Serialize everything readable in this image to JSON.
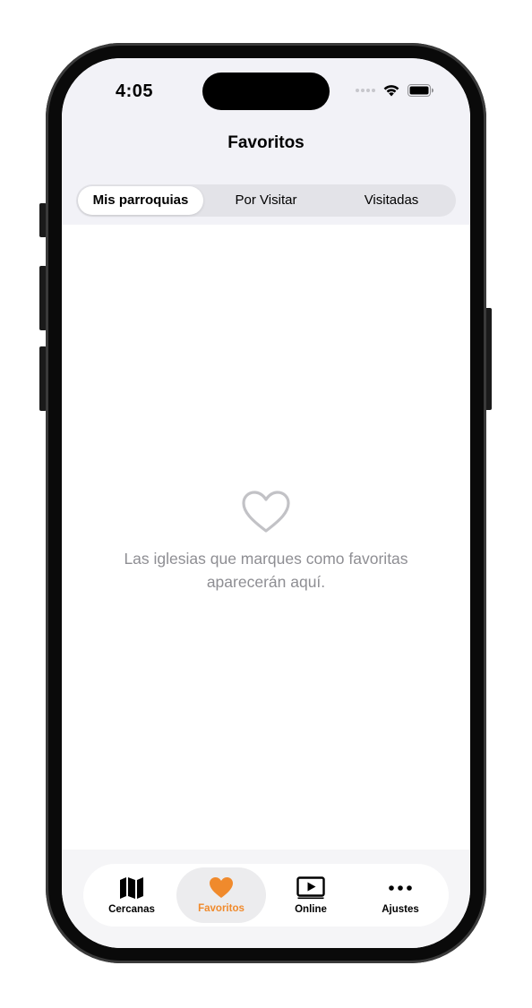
{
  "status_bar": {
    "time": "4:05"
  },
  "nav": {
    "title": "Favoritos"
  },
  "segmented": {
    "items": [
      "Mis parroquias",
      "Por Visitar",
      "Visitadas"
    ],
    "selected": "Mis parroquias"
  },
  "empty_state": {
    "icon": "heart-outline-icon",
    "message": "Las iglesias que marques como favoritas aparecerán aquí."
  },
  "tab_bar": {
    "tabs": [
      {
        "label": "Cercanas",
        "icon": "map-icon"
      },
      {
        "label": "Favoritos",
        "icon": "heart-icon"
      },
      {
        "label": "Online",
        "icon": "play-icon"
      },
      {
        "label": "Ajustes",
        "icon": "more-icon"
      }
    ],
    "active": "Favoritos"
  },
  "colors": {
    "accent": "#f08a2c",
    "header_bg": "#f2f2f7",
    "secondary_text": "#8e8e93"
  }
}
